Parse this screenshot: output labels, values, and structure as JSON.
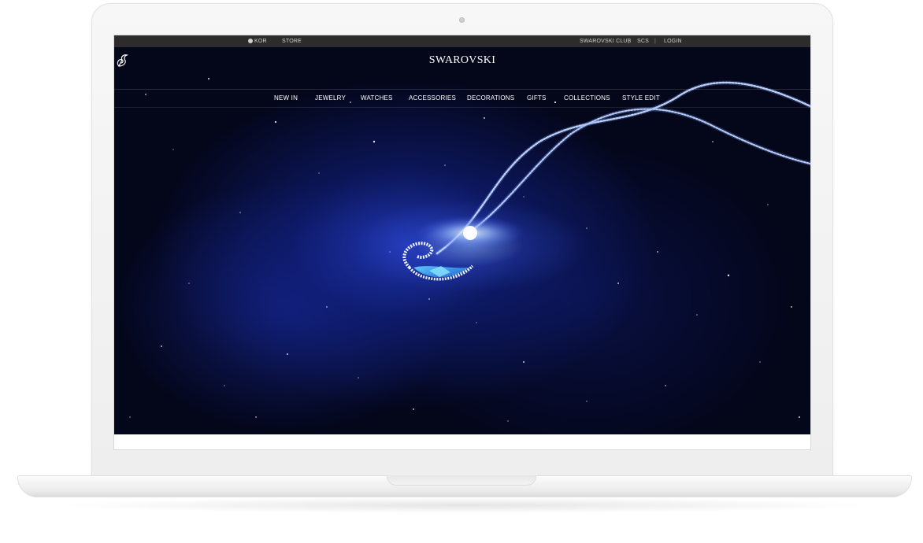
{
  "utility_bar": {
    "region": "KOR",
    "store": "STORE",
    "club": "SWAROVSKI CLUB",
    "scs": "SCS",
    "login": "LOGIN",
    "separator": "|"
  },
  "brand": {
    "name": "SWAROVSKI",
    "logo_icon": "swan-icon"
  },
  "nav": {
    "items": [
      {
        "label": "NEW IN"
      },
      {
        "label": "JEWELRY"
      },
      {
        "label": "WATCHES"
      },
      {
        "label": "ACCESSORIES"
      },
      {
        "label": "DECORATIONS"
      },
      {
        "label": "GIFTS"
      },
      {
        "label": "COLLECTIONS"
      },
      {
        "label": "STYLE EDIT"
      }
    ]
  },
  "hero": {
    "image": "crystal-swan-pendant-necklace"
  },
  "colors": {
    "topbar": "#2c2c2c",
    "hero_background": "#04061a",
    "accent_blue": "#2a4de0"
  }
}
